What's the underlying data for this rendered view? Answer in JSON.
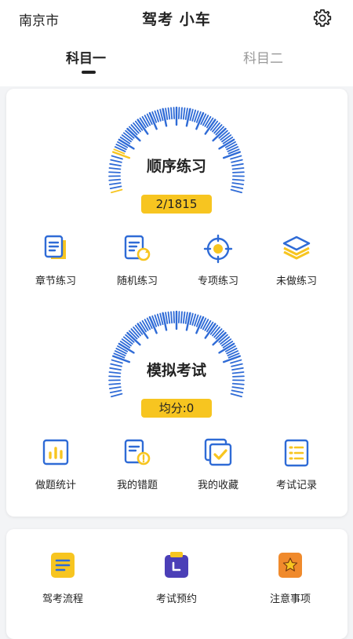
{
  "header": {
    "city": "南京市",
    "title": "驾考 小车"
  },
  "tabs": [
    {
      "label": "科目一",
      "active": true
    },
    {
      "label": "科目二",
      "active": false
    }
  ],
  "practice": {
    "title": "顺序练习",
    "badge": "2/1815",
    "progress": 0.0011,
    "features": [
      {
        "label": "章节练习",
        "icon": "document-icon"
      },
      {
        "label": "随机练习",
        "icon": "shuffle-doc-icon"
      },
      {
        "label": "专项练习",
        "icon": "target-icon"
      },
      {
        "label": "未做练习",
        "icon": "layers-icon"
      }
    ]
  },
  "exam": {
    "title": "模拟考试",
    "badge": "均分:0",
    "features": [
      {
        "label": "做题统计",
        "icon": "bar-chart-icon"
      },
      {
        "label": "我的错题",
        "icon": "wrong-doc-icon"
      },
      {
        "label": "我的收藏",
        "icon": "favorite-check-icon"
      },
      {
        "label": "考试记录",
        "icon": "list-doc-icon"
      }
    ]
  },
  "tools": [
    {
      "label": "驾考流程",
      "icon": "process-icon"
    },
    {
      "label": "考试预约",
      "icon": "appointment-icon"
    },
    {
      "label": "注意事项",
      "icon": "notice-star-icon"
    }
  ],
  "colors": {
    "accent_blue": "#2f6bd6",
    "accent_yellow": "#f7c520",
    "tick_light": "#c9d6ef"
  }
}
